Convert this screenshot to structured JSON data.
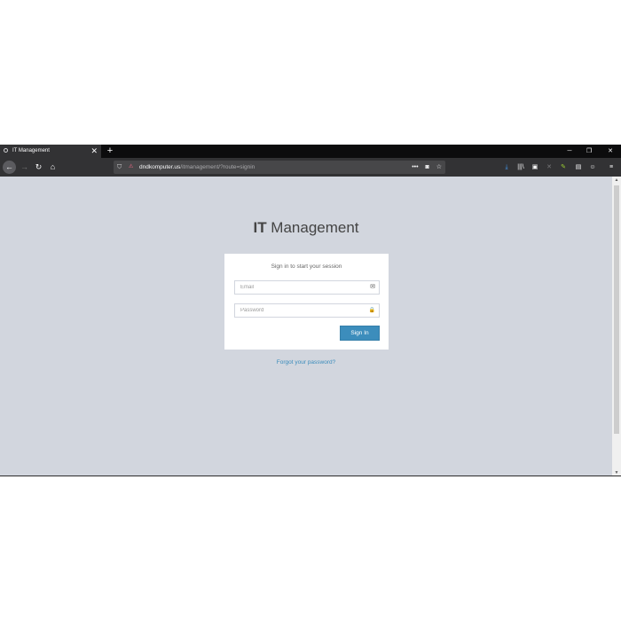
{
  "browser": {
    "tab_title": "IT Management",
    "tab_close": "✕",
    "new_tab": "+",
    "win_minimize": "─",
    "win_restore": "❐",
    "win_close": "✕",
    "url_host": "dndkomputer.us",
    "url_path": "/itmanagement/?route=signin",
    "nav_back": "←",
    "nav_forward": "→",
    "nav_reload": "↻",
    "nav_home": "⌂",
    "url_more": "•••",
    "url_pocket": "◙",
    "url_star": "☆",
    "tool_download": "⤓",
    "tool_library": "|||\\",
    "tool_sidebar": "▣",
    "tool_x": "✕",
    "tool_brush": "✎",
    "tool_reader": "▤",
    "tool_account": "☺",
    "tool_menu": "≡"
  },
  "page": {
    "logo_bold": "IT",
    "logo_rest": " Management",
    "box_message": "Sign in to start your session",
    "email_placeholder": "Email",
    "email_icon": "✉",
    "password_placeholder": "Password",
    "password_icon": "🔒",
    "signin_label": "Sign In",
    "forgot_label": "Forgot your password?"
  },
  "colors": {
    "background": "#d2d6de",
    "button": "#3c8dbc",
    "link": "#3c8dbc"
  }
}
